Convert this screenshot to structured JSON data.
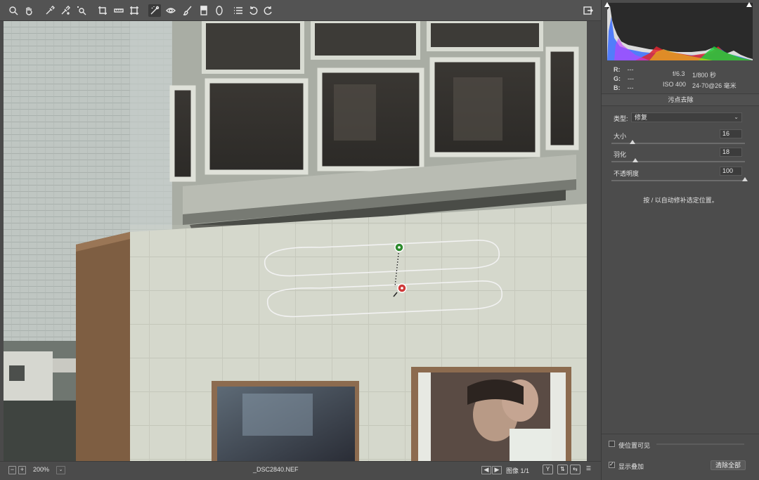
{
  "toolbar": {
    "tools": [
      "zoom-icon",
      "hand-icon",
      "white-balance-icon",
      "color-sampler-icon",
      "target-adjust-icon",
      "crop-icon",
      "straighten-icon",
      "transform-icon",
      "spot-removal-icon",
      "red-eye-icon",
      "adjustment-brush-icon",
      "graduated-filter-icon",
      "radial-filter-icon",
      "presets-list-icon",
      "rotate-left-icon",
      "rotate-right-icon"
    ],
    "active_tool": "spot-removal-icon",
    "export_icon": "open-export-icon"
  },
  "status": {
    "zoom_value": "200%",
    "filename": "_DSC2840.NEF",
    "image_counter": "图像 1/1",
    "buttons": [
      "Y",
      "compare-icon",
      "swap-icon",
      "settings-icon"
    ]
  },
  "panel": {
    "rgb": {
      "r_label": "R:",
      "g_label": "G:",
      "b_label": "B:",
      "r_value": "---",
      "g_value": "---",
      "b_value": "---"
    },
    "exif": {
      "aperture": "f/6.3",
      "shutter": "1/800 秒",
      "iso": "ISO 400",
      "lens": "24-70@26 毫米"
    },
    "title": "污点去除",
    "type_label": "类型:",
    "type_value": "修复",
    "size_label": "大小",
    "size_value": "16",
    "size_fraction": 0.16,
    "feather_label": "羽化",
    "feather_value": "18",
    "feather_fraction": 0.18,
    "opacity_label": "不透明度",
    "opacity_value": "100",
    "opacity_fraction": 1.0,
    "hint": "按 / 以自动修补选定位置。",
    "visualize_label": "使位置可见",
    "visualize_checked": false,
    "overlay_label": "显示叠加",
    "overlay_checked": true,
    "clear_all_label": "清除全部"
  }
}
